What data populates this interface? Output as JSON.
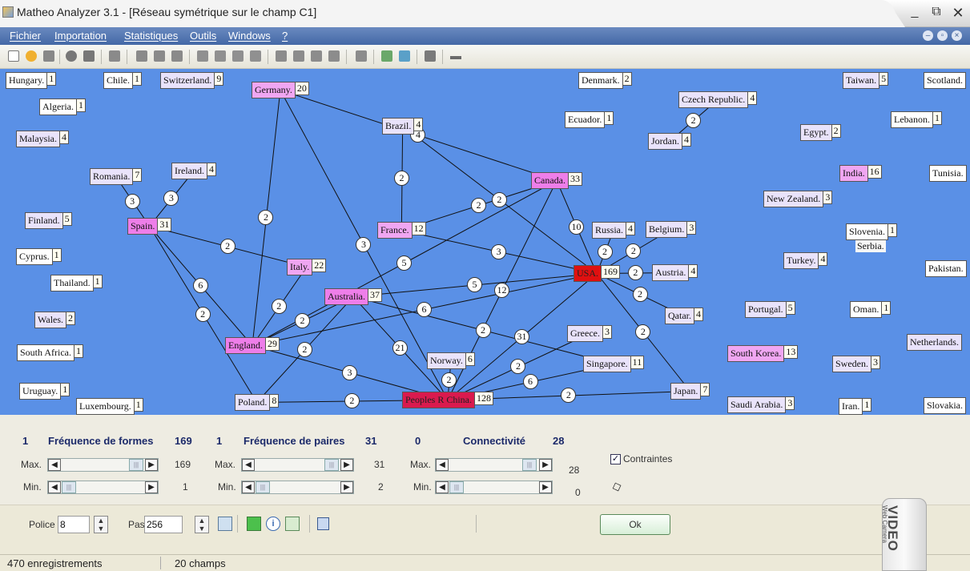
{
  "window": {
    "title": "Matheo Analyzer 3.1 - [Réseau symétrique sur le champ C1]",
    "minimize": "_",
    "restore": "⧉",
    "close": "✕"
  },
  "menu": {
    "items": [
      "Fichier",
      "Importation",
      "Statistiques",
      "Outils",
      "Windows",
      "?"
    ]
  },
  "graph": {
    "nodes": [
      {
        "id": "hungary",
        "label": "Hungary.",
        "count": "1",
        "style": "white"
      },
      {
        "id": "chile",
        "label": "Chile.",
        "count": "1",
        "style": "white"
      },
      {
        "id": "switzerland",
        "label": "Switzerland.",
        "count": "9",
        "style": "lav"
      },
      {
        "id": "germany",
        "label": "Germany.",
        "count": "20",
        "style": "pink"
      },
      {
        "id": "denmark",
        "label": "Denmark.",
        "count": "2",
        "style": "white"
      },
      {
        "id": "taiwan",
        "label": "Taiwan.",
        "count": "5",
        "style": "lav"
      },
      {
        "id": "scotland",
        "label": "Scotland.",
        "count": "",
        "style": "white"
      },
      {
        "id": "algeria",
        "label": "Algeria.",
        "count": "1",
        "style": "white"
      },
      {
        "id": "czech",
        "label": "Czech Republic.",
        "count": "4",
        "style": "lav"
      },
      {
        "id": "brazil",
        "label": "Brazil.",
        "count": "4",
        "style": "lav"
      },
      {
        "id": "ecuador",
        "label": "Ecuador.",
        "count": "1",
        "style": "white"
      },
      {
        "id": "lebanon",
        "label": "Lebanon.",
        "count": "1",
        "style": "white"
      },
      {
        "id": "malaysia",
        "label": "Malaysia.",
        "count": "4",
        "style": "lav"
      },
      {
        "id": "jordan",
        "label": "Jordan.",
        "count": "4",
        "style": "lav"
      },
      {
        "id": "egypt",
        "label": "Egypt.",
        "count": "2",
        "style": "lav"
      },
      {
        "id": "romania",
        "label": "Romania.",
        "count": "7",
        "style": "lav"
      },
      {
        "id": "ireland",
        "label": "Ireland.",
        "count": "4",
        "style": "lav"
      },
      {
        "id": "india",
        "label": "India.",
        "count": "16",
        "style": "pink"
      },
      {
        "id": "tunisia",
        "label": "Tunisia.",
        "count": "",
        "style": "white"
      },
      {
        "id": "canada",
        "label": "Canada.",
        "count": "33",
        "style": "magenta"
      },
      {
        "id": "newzealand",
        "label": "New Zealand.",
        "count": "3",
        "style": "lav"
      },
      {
        "id": "finland",
        "label": "Finland.",
        "count": "5",
        "style": "lav"
      },
      {
        "id": "spain",
        "label": "Spain.",
        "count": "31",
        "style": "magenta"
      },
      {
        "id": "france",
        "label": "France.",
        "count": "12",
        "style": "pink"
      },
      {
        "id": "russia",
        "label": "Russia.",
        "count": "4",
        "style": "lav"
      },
      {
        "id": "belgium",
        "label": "Belgium.",
        "count": "3",
        "style": "lav"
      },
      {
        "id": "slovenia",
        "label": "Slovenia.",
        "count": "1",
        "style": "white"
      },
      {
        "id": "cyprus",
        "label": "Cyprus.",
        "count": "1",
        "style": "white"
      },
      {
        "id": "turkey",
        "label": "Turkey.",
        "count": "4",
        "style": "lav"
      },
      {
        "id": "italy",
        "label": "Italy.",
        "count": "22",
        "style": "pink"
      },
      {
        "id": "usa",
        "label": "USA.",
        "count": "169",
        "style": "red"
      },
      {
        "id": "austria",
        "label": "Austria.",
        "count": "4",
        "style": "lav"
      },
      {
        "id": "pakistan",
        "label": "Pakistan.",
        "count": "",
        "style": "white"
      },
      {
        "id": "thailand",
        "label": "Thailand.",
        "count": "1",
        "style": "white"
      },
      {
        "id": "australia",
        "label": "Australia.",
        "count": "37",
        "style": "magenta"
      },
      {
        "id": "portugal",
        "label": "Portugal.",
        "count": "5",
        "style": "lav"
      },
      {
        "id": "oman",
        "label": "Oman.",
        "count": "1",
        "style": "white"
      },
      {
        "id": "qatar",
        "label": "Qatar.",
        "count": "4",
        "style": "lav"
      },
      {
        "id": "wales",
        "label": "Wales.",
        "count": "2",
        "style": "lav"
      },
      {
        "id": "greece",
        "label": "Greece.",
        "count": "3",
        "style": "lav"
      },
      {
        "id": "netherlands",
        "label": "Netherlands.",
        "count": "",
        "style": "lav"
      },
      {
        "id": "southafrica",
        "label": "South Africa.",
        "count": "1",
        "style": "white"
      },
      {
        "id": "england",
        "label": "England.",
        "count": "29",
        "style": "magenta"
      },
      {
        "id": "norway",
        "label": "Norway.",
        "count": "6",
        "style": "lav"
      },
      {
        "id": "southkorea",
        "label": "South Korea.",
        "count": "13",
        "style": "pink"
      },
      {
        "id": "singapore",
        "label": "Singapore.",
        "count": "11",
        "style": "lav"
      },
      {
        "id": "sweden",
        "label": "Sweden.",
        "count": "3",
        "style": "lav"
      },
      {
        "id": "uruguay",
        "label": "Uruguay.",
        "count": "1",
        "style": "white"
      },
      {
        "id": "luxembourg",
        "label": "Luxembourg.",
        "count": "1",
        "style": "white"
      },
      {
        "id": "poland",
        "label": "Poland.",
        "count": "8",
        "style": "lav"
      },
      {
        "id": "china",
        "label": "Peoples R China.",
        "count": "128",
        "style": "crimson"
      },
      {
        "id": "japan",
        "label": "Japan.",
        "count": "7",
        "style": "lav"
      },
      {
        "id": "saudi",
        "label": "Saudi Arabia.",
        "count": "3",
        "style": "lav"
      },
      {
        "id": "iran",
        "label": "Iran.",
        "count": "1",
        "style": "white"
      },
      {
        "id": "slovakia",
        "label": "Slovakia.",
        "count": "",
        "style": "white"
      }
    ],
    "extra_labels": {
      "serbia": "Serbia."
    },
    "edges": [
      {
        "from": "germany",
        "to": "canada",
        "weight": "4"
      },
      {
        "from": "germany",
        "to": "china",
        "weight": "3"
      },
      {
        "from": "germany",
        "to": "england",
        "weight": "2"
      },
      {
        "from": "brazil",
        "to": "france",
        "weight": "2"
      },
      {
        "from": "brazil",
        "to": "usa",
        "weight": "2"
      },
      {
        "from": "romania",
        "to": "spain",
        "weight": "3"
      },
      {
        "from": "ireland",
        "to": "spain",
        "weight": "3"
      },
      {
        "from": "spain",
        "to": "italy",
        "weight": "2"
      },
      {
        "from": "spain",
        "to": "england",
        "weight": "6"
      },
      {
        "from": "spain",
        "to": "poland",
        "weight": "2"
      },
      {
        "from": "france",
        "to": "canada",
        "weight": "2"
      },
      {
        "from": "france",
        "to": "usa",
        "weight": "3"
      },
      {
        "from": "canada",
        "to": "usa",
        "weight": "10"
      },
      {
        "from": "canada",
        "to": "england",
        "weight": "5"
      },
      {
        "from": "canada",
        "to": "china",
        "weight": "12"
      },
      {
        "from": "czech",
        "to": "jordan",
        "weight": "2"
      },
      {
        "from": "usa",
        "to": "russia",
        "weight": "2"
      },
      {
        "from": "usa",
        "to": "belgium",
        "weight": "2"
      },
      {
        "from": "usa",
        "to": "austria",
        "weight": "2"
      },
      {
        "from": "usa",
        "to": "qatar",
        "weight": "2"
      },
      {
        "from": "usa",
        "to": "australia",
        "weight": "5"
      },
      {
        "from": "usa",
        "to": "england",
        "weight": "6"
      },
      {
        "from": "usa",
        "to": "china",
        "weight": "31"
      },
      {
        "from": "usa",
        "to": "japan",
        "weight": "2"
      },
      {
        "from": "italy",
        "to": "england",
        "weight": "2"
      },
      {
        "from": "australia",
        "to": "england",
        "weight": "2"
      },
      {
        "from": "australia",
        "to": "china",
        "weight": "21"
      },
      {
        "from": "australia",
        "to": "singapore",
        "weight": "2"
      },
      {
        "from": "australia",
        "to": "poland",
        "weight": "2"
      },
      {
        "from": "england",
        "to": "china",
        "weight": "3"
      },
      {
        "from": "poland",
        "to": "china",
        "weight": "2"
      },
      {
        "from": "norway",
        "to": "china",
        "weight": "2"
      },
      {
        "from": "greece",
        "to": "china",
        "weight": "2"
      },
      {
        "from": "singapore",
        "to": "china",
        "weight": "6"
      },
      {
        "from": "china",
        "to": "japan",
        "weight": "2"
      }
    ]
  },
  "filters": {
    "forms": {
      "min_value": "1",
      "label": "Fréquence de formes",
      "max_value": "169",
      "max_label": "Max.",
      "max_reading": "169",
      "min_label": "Min.",
      "min_reading": "1"
    },
    "pairs": {
      "min_value": "1",
      "label": "Fréquence de paires",
      "max_value": "31",
      "max_label": "Max.",
      "max_reading": "31",
      "min_label": "Min.",
      "min_reading": "2"
    },
    "connectivity": {
      "min_value": "0",
      "label": "Connectivité",
      "max_value": "28",
      "max_label": "Max.",
      "max_reading": "28",
      "min_label": "Min.",
      "min_reading": "0"
    },
    "constraints_label": "Contraintes",
    "constraints_checked": true
  },
  "bottom": {
    "font_label": "Police",
    "font_value": "8",
    "step_label": "Pas",
    "step_value": "256",
    "ok_label": "Ok"
  },
  "status": {
    "records": "470 enregistrements",
    "fields": "20 champs"
  },
  "watermark": {
    "brand": "VIDEO",
    "sub": "Web Camera"
  }
}
